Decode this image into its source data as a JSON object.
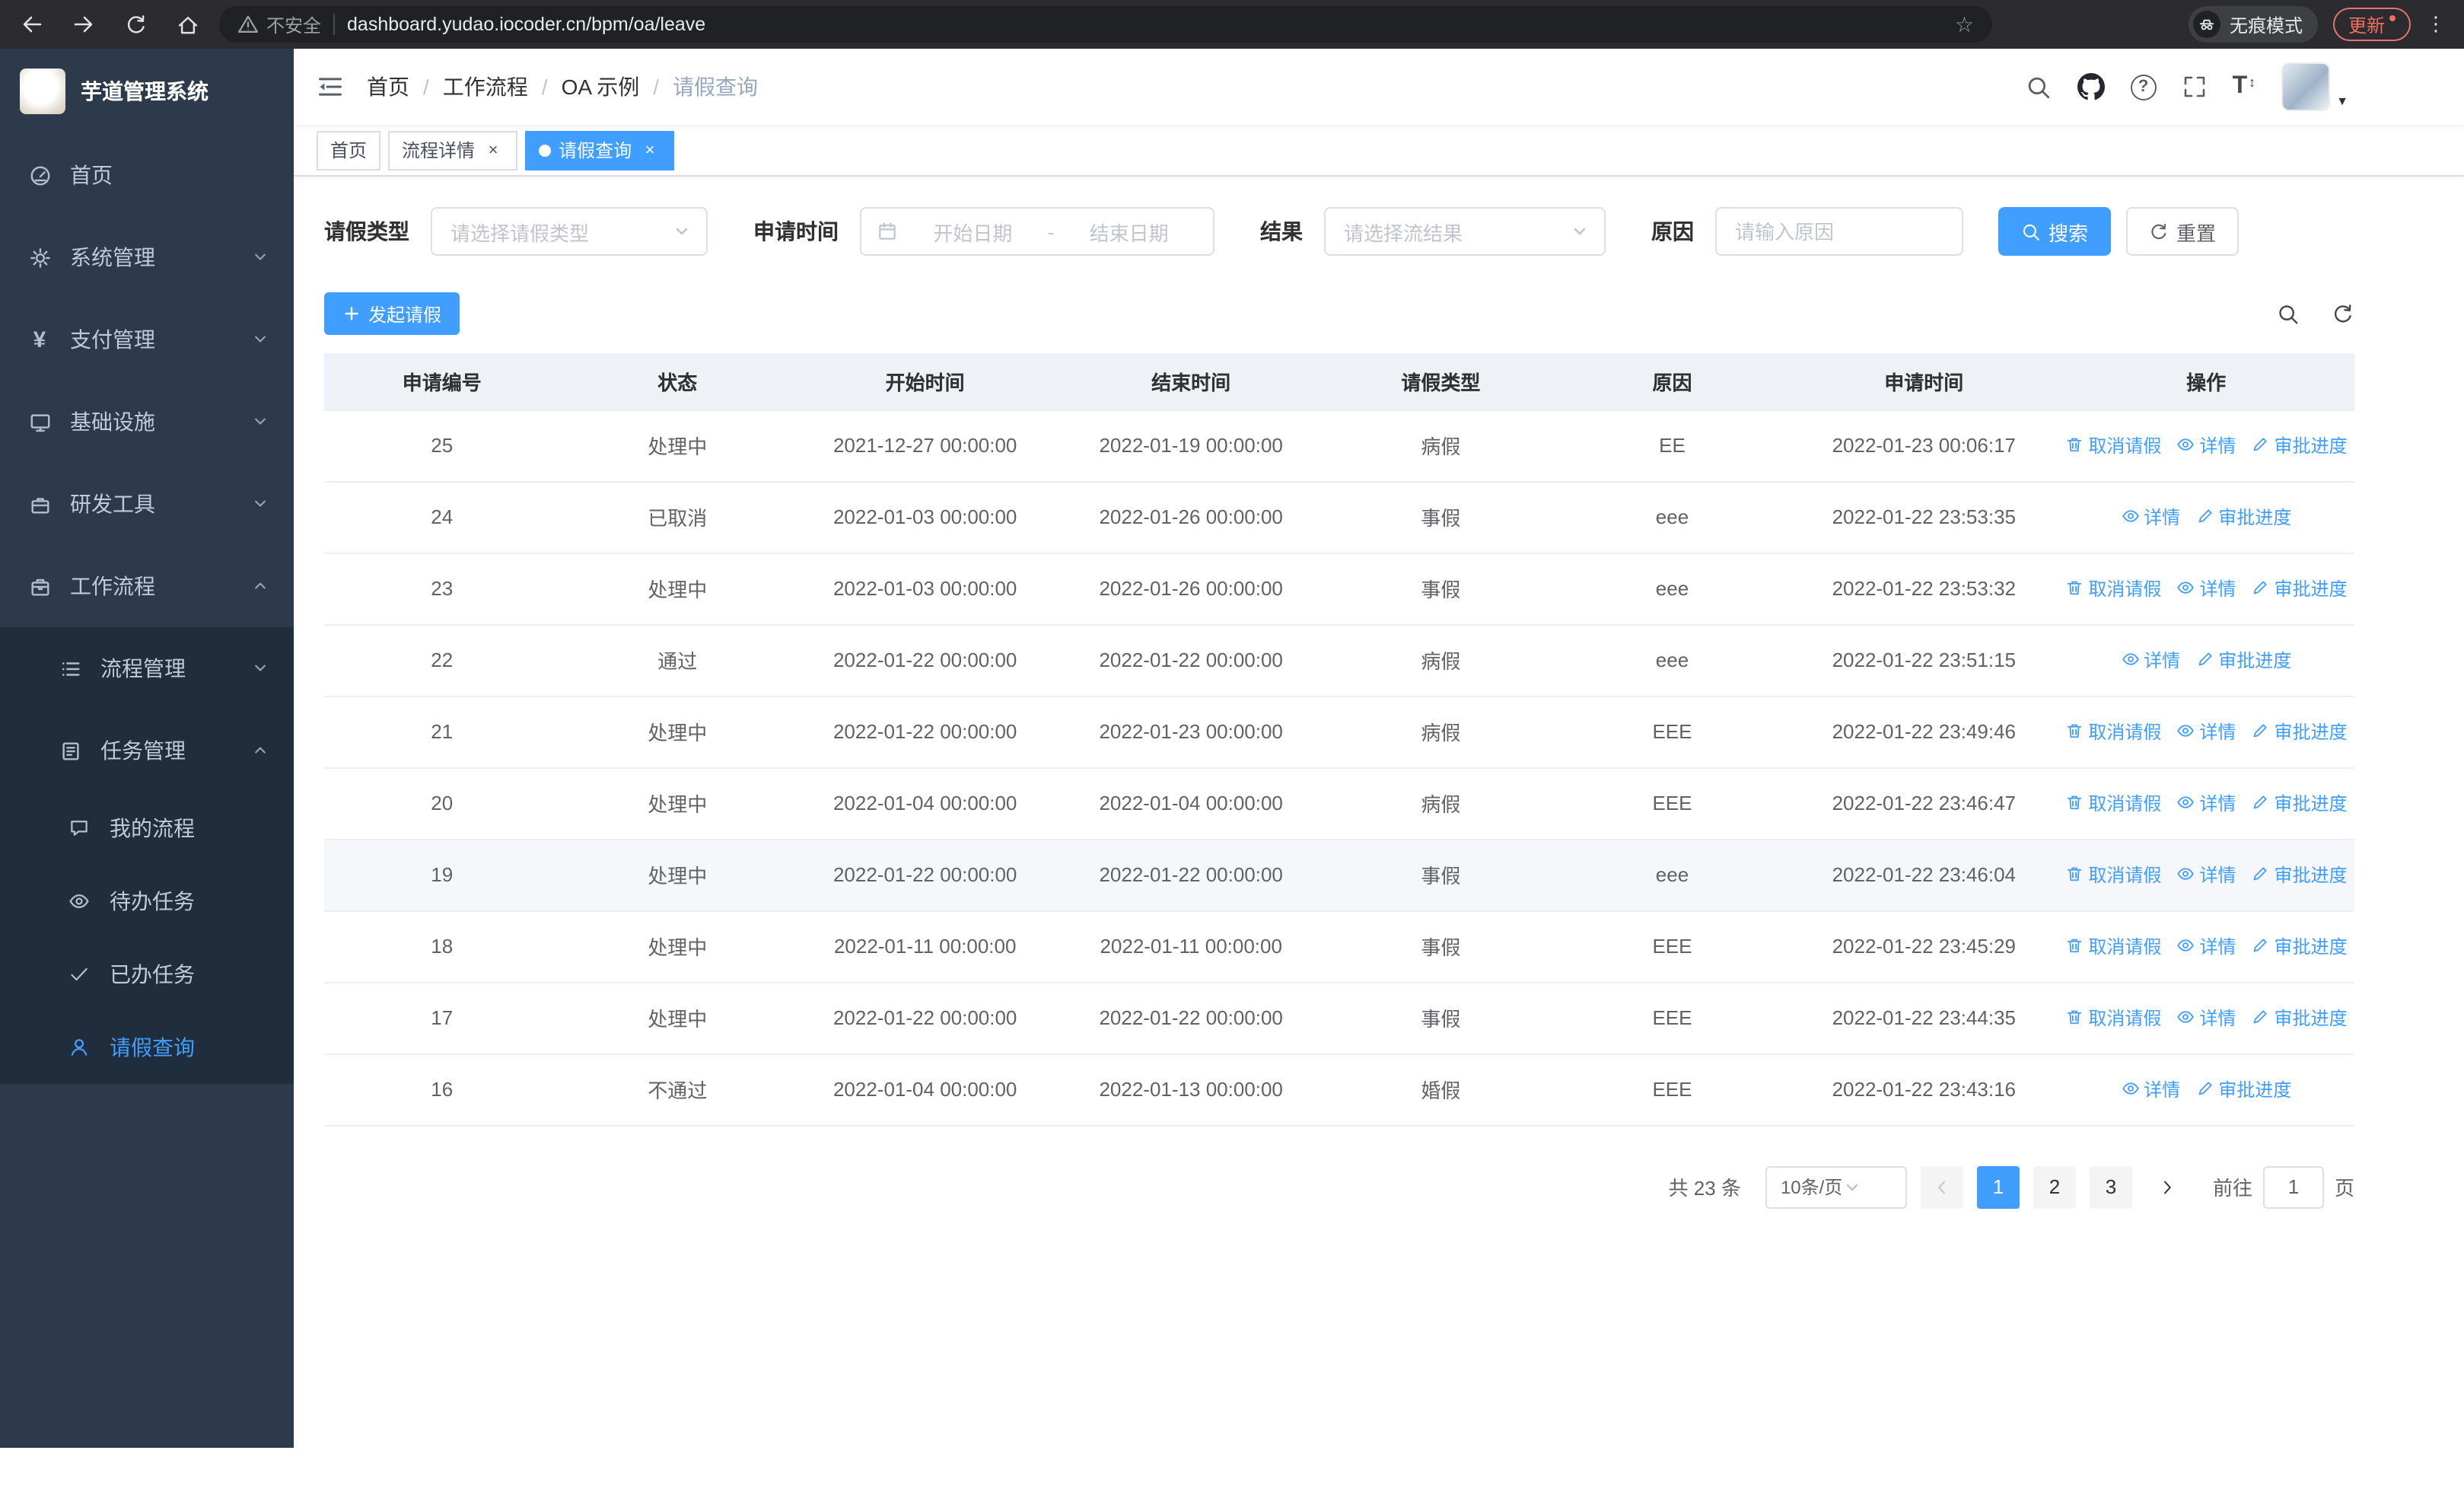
{
  "browser": {
    "security_label": "不安全",
    "url": "dashboard.yudao.iocoder.cn/bpm/oa/leave",
    "incognito_label": "无痕模式",
    "update_label": "更新"
  },
  "sidebar": {
    "app_title": "芋道管理系统",
    "items": [
      {
        "label": "首页",
        "icon": "dashboard-icon"
      },
      {
        "label": "系统管理",
        "icon": "gear-icon"
      },
      {
        "label": "支付管理",
        "icon": "payment-icon"
      },
      {
        "label": "基础设施",
        "icon": "infrastructure-icon"
      },
      {
        "label": "研发工具",
        "icon": "devtools-icon"
      },
      {
        "label": "工作流程",
        "icon": "workflow-icon"
      }
    ],
    "workflow_children": [
      {
        "label": "流程管理",
        "icon": "process-icon"
      },
      {
        "label": "任务管理",
        "icon": "task-icon"
      }
    ],
    "task_children": [
      {
        "label": "我的流程",
        "icon": "my-process-icon"
      },
      {
        "label": "待办任务",
        "icon": "todo-icon"
      },
      {
        "label": "已办任务",
        "icon": "done-icon"
      },
      {
        "label": "请假查询",
        "icon": "user-icon"
      }
    ]
  },
  "header": {
    "breadcrumb": [
      "首页",
      "工作流程",
      "OA 示例",
      "请假查询"
    ]
  },
  "tabs": [
    {
      "label": "首页"
    },
    {
      "label": "流程详情"
    },
    {
      "label": "请假查询"
    }
  ],
  "filters": {
    "leave_type_label": "请假类型",
    "leave_type_placeholder": "请选择请假类型",
    "apply_time_label": "申请时间",
    "start_placeholder": "开始日期",
    "range_separator": "-",
    "end_placeholder": "结束日期",
    "result_label": "结果",
    "result_placeholder": "请选择流结果",
    "reason_label": "原因",
    "reason_placeholder": "请输入原因",
    "search_label": "搜索",
    "reset_label": "重置"
  },
  "toolbar": {
    "create_label": "发起请假"
  },
  "table": {
    "columns": [
      "申请编号",
      "状态",
      "开始时间",
      "结束时间",
      "请假类型",
      "原因",
      "申请时间",
      "操作"
    ],
    "action_labels": {
      "cancel": "取消请假",
      "detail": "详情",
      "progress": "审批进度"
    },
    "rows": [
      {
        "id": "25",
        "status": "处理中",
        "start": "2021-12-27 00:00:00",
        "end": "2022-01-19 00:00:00",
        "type": "病假",
        "reason": "EE",
        "apply_time": "2022-01-23 00:06:17",
        "cancelable": true
      },
      {
        "id": "24",
        "status": "已取消",
        "start": "2022-01-03 00:00:00",
        "end": "2022-01-26 00:00:00",
        "type": "事假",
        "reason": "eee",
        "apply_time": "2022-01-22 23:53:35",
        "cancelable": false
      },
      {
        "id": "23",
        "status": "处理中",
        "start": "2022-01-03 00:00:00",
        "end": "2022-01-26 00:00:00",
        "type": "事假",
        "reason": "eee",
        "apply_time": "2022-01-22 23:53:32",
        "cancelable": true
      },
      {
        "id": "22",
        "status": "通过",
        "start": "2022-01-22 00:00:00",
        "end": "2022-01-22 00:00:00",
        "type": "病假",
        "reason": "eee",
        "apply_time": "2022-01-22 23:51:15",
        "cancelable": false
      },
      {
        "id": "21",
        "status": "处理中",
        "start": "2022-01-22 00:00:00",
        "end": "2022-01-23 00:00:00",
        "type": "病假",
        "reason": "EEE",
        "apply_time": "2022-01-22 23:49:46",
        "cancelable": true
      },
      {
        "id": "20",
        "status": "处理中",
        "start": "2022-01-04 00:00:00",
        "end": "2022-01-04 00:00:00",
        "type": "病假",
        "reason": "EEE",
        "apply_time": "2022-01-22 23:46:47",
        "cancelable": true
      },
      {
        "id": "19",
        "status": "处理中",
        "start": "2022-01-22 00:00:00",
        "end": "2022-01-22 00:00:00",
        "type": "事假",
        "reason": "eee",
        "apply_time": "2022-01-22 23:46:04",
        "cancelable": true,
        "highlighted": true
      },
      {
        "id": "18",
        "status": "处理中",
        "start": "2022-01-11 00:00:00",
        "end": "2022-01-11 00:00:00",
        "type": "事假",
        "reason": "EEE",
        "apply_time": "2022-01-22 23:45:29",
        "cancelable": true
      },
      {
        "id": "17",
        "status": "处理中",
        "start": "2022-01-22 00:00:00",
        "end": "2022-01-22 00:00:00",
        "type": "事假",
        "reason": "EEE",
        "apply_time": "2022-01-22 23:44:35",
        "cancelable": true
      },
      {
        "id": "16",
        "status": "不通过",
        "start": "2022-01-04 00:00:00",
        "end": "2022-01-13 00:00:00",
        "type": "婚假",
        "reason": "EEE",
        "apply_time": "2022-01-22 23:43:16",
        "cancelable": false
      }
    ]
  },
  "pagination": {
    "total": "共 23 条",
    "page_size": "10条/页",
    "pages": [
      "1",
      "2",
      "3"
    ],
    "active_page": "1",
    "goto_label": "前往",
    "goto_value": "1",
    "goto_suffix": "页"
  },
  "colors": {
    "accent": "#409eff",
    "sidebar_bg": "#2d3a4b",
    "submenu_bg": "#1f2d3d"
  }
}
